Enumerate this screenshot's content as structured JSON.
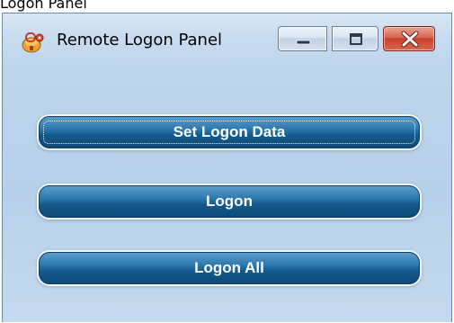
{
  "clipped_title": "Logon Panel",
  "window": {
    "title": "Remote Logon Panel",
    "app_icon": "key-lock-icon",
    "controls": {
      "minimize_icon": "minimize-icon",
      "maximize_icon": "maximize-icon",
      "close_icon": "close-icon"
    }
  },
  "buttons": {
    "set_logon_data": "Set Logon Data",
    "logon": "Logon",
    "logon_all": "Logon All"
  },
  "colors": {
    "button_fill": "#1a5f94",
    "button_text": "#ffffff",
    "window_bg": "#bdd4ec",
    "close_button": "#c8412a"
  }
}
